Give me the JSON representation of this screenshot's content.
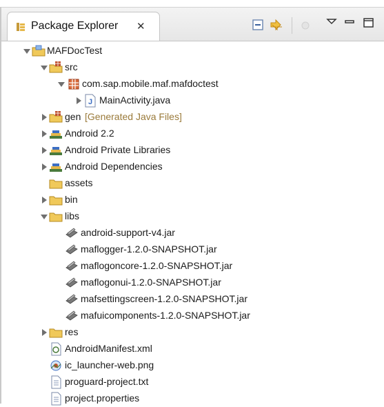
{
  "view": {
    "title": "Package Explorer",
    "close_glyph": "✕"
  },
  "tree": {
    "project": "MAFDocTest",
    "src": "src",
    "package": "com.sap.mobile.maf.mafdoctest",
    "main_activity": "MainActivity.java",
    "gen": "gen",
    "gen_decoration": "[Generated Java Files]",
    "android_22": "Android 2.2",
    "android_private": "Android Private Libraries",
    "android_deps": "Android Dependencies",
    "assets": "assets",
    "bin": "bin",
    "libs": "libs",
    "jars": [
      "android-support-v4.jar",
      "maflogger-1.2.0-SNAPSHOT.jar",
      "maflogoncore-1.2.0-SNAPSHOT.jar",
      "maflogonui-1.2.0-SNAPSHOT.jar",
      "mafsettingscreen-1.2.0-SNAPSHOT.jar",
      "mafuicomponents-1.2.0-SNAPSHOT.jar"
    ],
    "res": "res",
    "manifest": "AndroidManifest.xml",
    "launcher": "ic_launcher-web.png",
    "proguard": "proguard-project.txt",
    "properties": "project.properties"
  },
  "colors": {
    "folder": "#e6b84a",
    "library": "#4a7b3c",
    "package": "#c0502a",
    "java": "#3d6fc4"
  },
  "icons": {
    "view_icon": "package-explorer-icon",
    "collapse_all": "collapse-all-icon",
    "link_editor": "link-with-editor-icon",
    "view_menu": "view-menu-icon",
    "minimize": "minimize-icon",
    "maximize": "maximize-icon"
  }
}
